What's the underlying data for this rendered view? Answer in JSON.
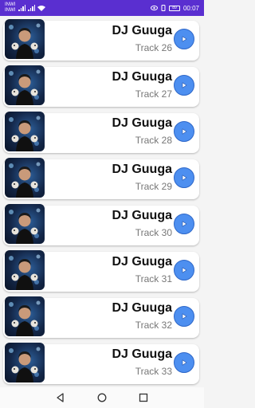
{
  "status_bar": {
    "carrier_top": "INWI",
    "carrier_bottom": "INWI",
    "battery": "89",
    "time": "00:07"
  },
  "tracks": [
    {
      "artist": "DJ Guuga",
      "track": "Track 26"
    },
    {
      "artist": "DJ Guuga",
      "track": "Track 27"
    },
    {
      "artist": "DJ Guuga",
      "track": "Track 28"
    },
    {
      "artist": "DJ Guuga",
      "track": "Track 29"
    },
    {
      "artist": "DJ Guuga",
      "track": "Track 30"
    },
    {
      "artist": "DJ Guuga",
      "track": "Track 31"
    },
    {
      "artist": "DJ Guuga",
      "track": "Track 32"
    },
    {
      "artist": "DJ Guuga",
      "track": "Track 33"
    }
  ],
  "colors": {
    "status_bar": "#5a2fd0",
    "play_button": "#4d8ff0"
  },
  "icons": {
    "play": "play-icon",
    "back": "back-icon",
    "home": "home-icon",
    "recents": "recents-icon"
  }
}
